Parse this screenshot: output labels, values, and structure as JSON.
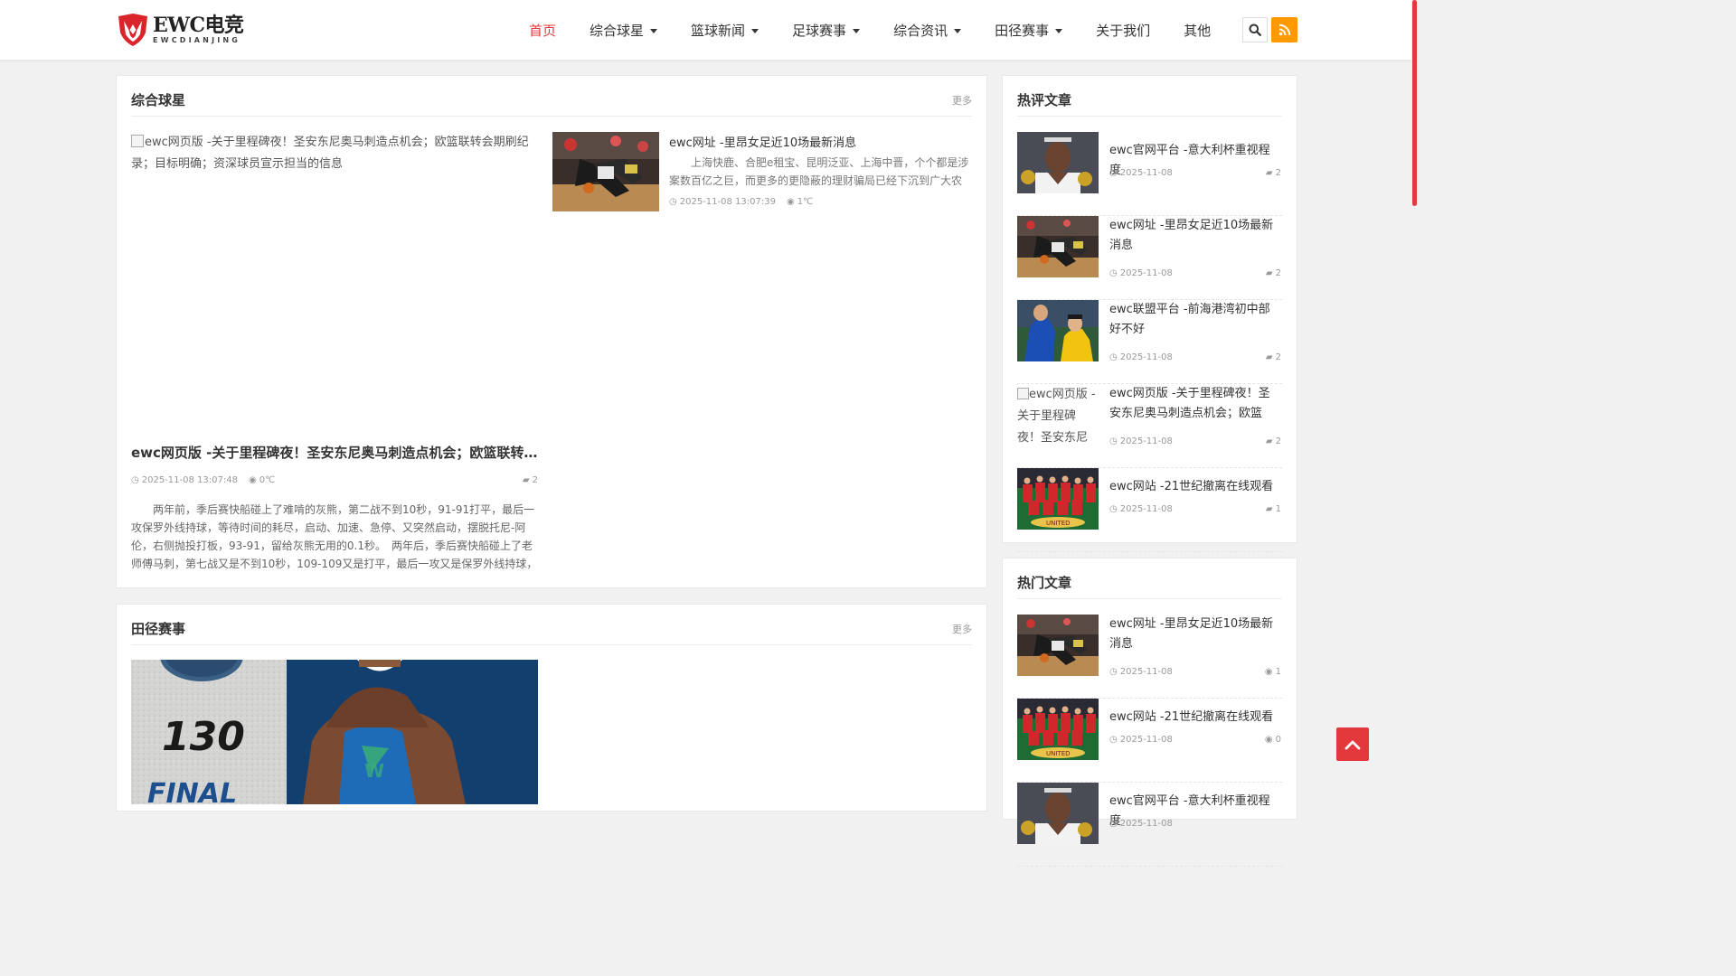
{
  "logo": {
    "main": "EWC电竞",
    "sub": "EWCDIANJING"
  },
  "nav": [
    {
      "label": "首页",
      "active": true,
      "dropdown": false
    },
    {
      "label": "综合球星",
      "active": false,
      "dropdown": true
    },
    {
      "label": "篮球新闻",
      "active": false,
      "dropdown": true
    },
    {
      "label": "足球赛事",
      "active": false,
      "dropdown": true
    },
    {
      "label": "综合资讯",
      "active": false,
      "dropdown": true
    },
    {
      "label": "田径赛事",
      "active": false,
      "dropdown": true
    },
    {
      "label": "关于我们",
      "active": false,
      "dropdown": false
    },
    {
      "label": "其他",
      "active": false,
      "dropdown": false
    }
  ],
  "colors": {
    "accent": "#e4393c",
    "rss": "#ff9900"
  },
  "section1": {
    "title": "综合球星",
    "more": "更多",
    "feature_alt": "ewc网页版 -关于里程碑夜！圣安东尼奥马刺造点机会；欧篮联转会期刷纪录；目标明确；资深球员宣示担当的信息",
    "feature_title": "ewc网页版 -关于里程碑夜！圣安东尼奥马刺造点机会；欧篮联转会…",
    "feature_date": "2025-11-08 13:07:48",
    "feature_views": "0℃",
    "feature_comments": "2",
    "feature_desc": "两年前，季后赛快船碰上了难啃的灰熊，第二战不到10秒，91-91打平，最后一攻保罗外线持球，等待时间的耗尽，启动、加速、急停、又突然启动，摆脱托尼-阿伦，右侧抛投打板，93-91，留给灰熊无用的0.1秒。　两年后，季后赛快船碰上了老师傅马刺，第七战又是不到10秒，109-109又是打平，最后一攻又是保罗外线持球，这一次他没有…",
    "side_title": "ewc网址 -里昂女足近10场最新消息",
    "side_desc": "上海快鹿、合肥e租宝、昆明泛亚、上海中晋，个个都是涉案数百亿之巨，而更多的更隐蔽的理财骗局已经下沉到广大农村千…",
    "side_date": "2025-11-08 13:07:39",
    "side_views": "1℃"
  },
  "section2": {
    "title": "田径赛事",
    "more": "更多",
    "poster_number": "130",
    "poster_word": "FINAL"
  },
  "hot_comments": {
    "title": "热评文章",
    "items": [
      {
        "title": "ewc官网平台 -意大利杯重视程度",
        "date": "2025-11-08",
        "count": "2",
        "thumb": "player"
      },
      {
        "title": "ewc网址 -里昂女足近10场最新消息",
        "date": "2025-11-08",
        "count": "2",
        "thumb": "basketball"
      },
      {
        "title": "ewc联盟平台 -前海港湾初中部好不好",
        "date": "2025-11-08",
        "count": "2",
        "thumb": "soccer"
      },
      {
        "title": "ewc网页版 -关于里程碑夜！圣安东尼奥马刺造点机会；欧篮联…",
        "date": "2025-11-08",
        "count": "2",
        "thumb": "broken",
        "alt": "ewc网页版 -关于里程碑夜！圣安东尼"
      },
      {
        "title": "ewc网站 -21世纪撤离在线观看",
        "date": "2025-11-08",
        "count": "1",
        "thumb": "team"
      }
    ]
  },
  "hot_articles": {
    "title": "热门文章",
    "items": [
      {
        "title": "ewc网址 -里昂女足近10场最新消息",
        "date": "2025-11-08",
        "count": "1",
        "thumb": "basketball"
      },
      {
        "title": "ewc网站 -21世纪撤离在线观看",
        "date": "2025-11-08",
        "count": "0",
        "thumb": "team"
      },
      {
        "title": "ewc官网平台 -意大利杯重视程度",
        "date": "2025-11-08",
        "count": "",
        "thumb": "player"
      }
    ]
  }
}
